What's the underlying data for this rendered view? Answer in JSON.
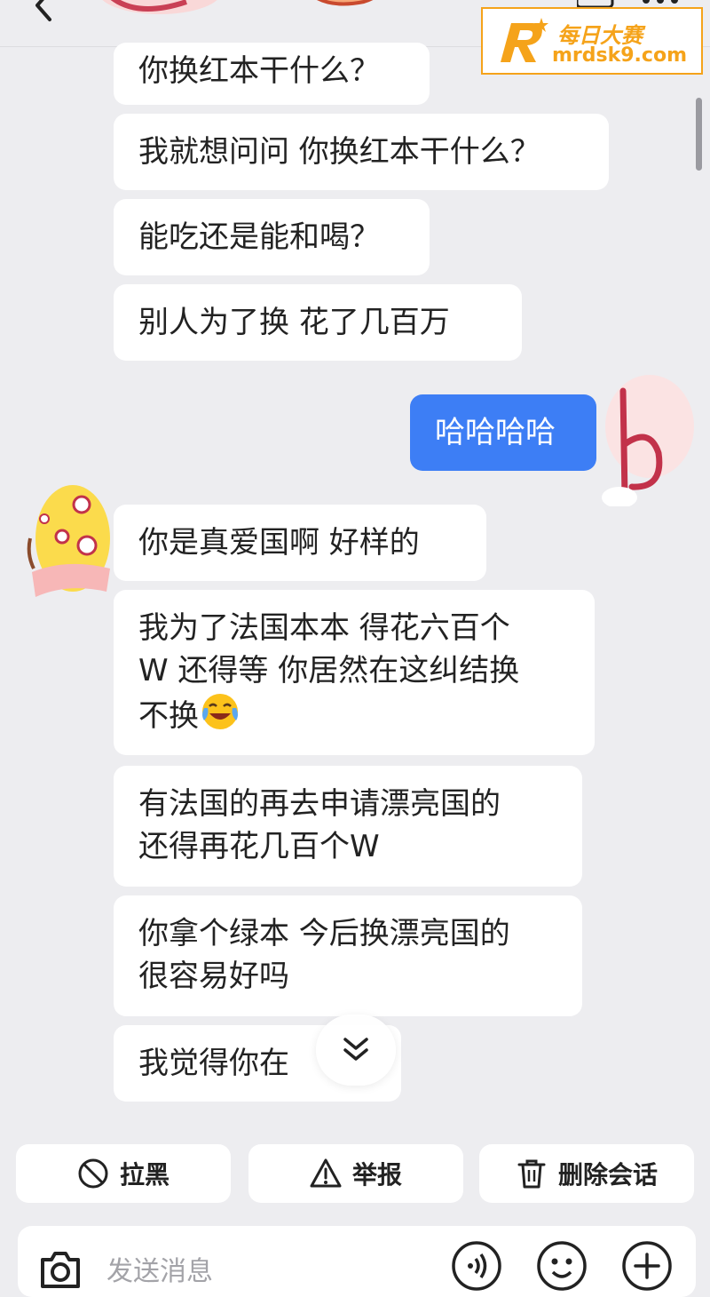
{
  "watermark": {
    "title": "每日大赛",
    "url": "mrdsk9.com",
    "color": "#f5a31a"
  },
  "messages": [
    {
      "side": "in",
      "lines": [
        "你换红本干什么？"
      ]
    },
    {
      "side": "in",
      "lines": [
        "我就想问问 你换红本干什么？"
      ]
    },
    {
      "side": "in",
      "lines": [
        "能吃还是能和喝？"
      ]
    },
    {
      "side": "in",
      "lines": [
        "别人为了换 花了几百万"
      ]
    },
    {
      "side": "out",
      "lines": [
        "哈哈哈哈"
      ]
    },
    {
      "side": "in",
      "lines": [
        "你是真爱国啊 好样的"
      ]
    },
    {
      "side": "in",
      "lines": [
        "我为了法国本本 得花六百个",
        "W 还得等 你居然在这纠结换",
        "不换"
      ],
      "trailing_emoji": "crying-laughing-emoji"
    },
    {
      "side": "in",
      "lines": [
        "有法国的再去申请漂亮国的",
        "还得再花几百个W"
      ]
    },
    {
      "side": "in",
      "lines": [
        "你拿个绿本 今后换漂亮国的",
        "很容易好吗"
      ]
    },
    {
      "side": "in",
      "lines": [
        "我觉得你在"
      ]
    }
  ],
  "actions": {
    "block": {
      "label": "拉黑",
      "icon": "block-icon"
    },
    "report": {
      "label": "举报",
      "icon": "warning-icon"
    },
    "delete": {
      "label": "删除会话",
      "icon": "trash-icon"
    }
  },
  "input": {
    "placeholder": "发送消息"
  },
  "colors": {
    "background": "#ededf0",
    "bubble_in": "#ffffff",
    "bubble_out": "#3d7ef5"
  }
}
